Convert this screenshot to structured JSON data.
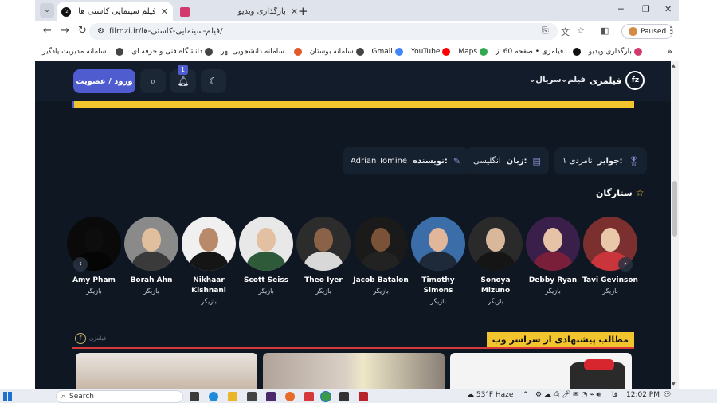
{
  "browser": {
    "tabs": [
      {
        "label": "فیلم سینمایی کاستی ها - فیلمزی",
        "active": true
      },
      {
        "label": "بارگذاری ویدیو",
        "active": false
      }
    ],
    "url": "filmzi.ir/فیلم-سینمایی-کاستی-ها/",
    "profile_label": "Paused",
    "bookmarks": [
      {
        "label": "بارگذاری ویدیو",
        "icon": "upload-icon",
        "color": "#d23a6d"
      },
      {
        "label": "فیلمزی • صفحه 60 از...",
        "icon": "filmzi-icon",
        "color": "#111111"
      },
      {
        "label": "Maps",
        "icon": "maps-icon",
        "color": "#34a853"
      },
      {
        "label": "YouTube",
        "icon": "youtube-icon",
        "color": "#ff0000"
      },
      {
        "label": "Gmail",
        "icon": "google-icon",
        "color": "#4285f4"
      },
      {
        "label": "سامانه بوستان",
        "icon": "bustan-icon",
        "color": "#444444"
      },
      {
        "label": "سامانه دانشجویی بهر...",
        "icon": "student-icon",
        "color": "#e05a2b"
      },
      {
        "label": "دانشگاه فنی و حرفه ای",
        "icon": "university-icon",
        "color": "#444444"
      },
      {
        "label": "سامانه مدیریت یادگیر...",
        "icon": "lms-icon",
        "color": "#444444"
      }
    ]
  },
  "site": {
    "login_label": "ورود / عضویت",
    "notification_count": "1",
    "nav": {
      "film": "فیلم",
      "series": "سریال"
    },
    "logo_mark": "fz",
    "logo_text": "فیلمزی",
    "accent_color": "#4f5ccf",
    "highlight_color": "#f2c42d"
  },
  "info": {
    "awards": {
      "label": "جوایز:",
      "value": "۱ نامزدی"
    },
    "language": {
      "label": "زبان:",
      "value": "انگلیسی"
    },
    "writer": {
      "label": "نویسنده:",
      "value": "Adrian Tomine"
    }
  },
  "cast_section": {
    "title": "ستارگان",
    "members": [
      {
        "name": "Tavi Gevinson",
        "role": "بازیگر",
        "bg": "#7b2f2f",
        "skin": "#e8c8a8",
        "cloth": "#c9353a"
      },
      {
        "name": "Debby Ryan",
        "role": "بازیگر",
        "bg": "#3a1f4a",
        "skin": "#e6c2a6",
        "cloth": "#7a1f3a"
      },
      {
        "name": "Sonoya Mizuno",
        "role": "بازیگر",
        "bg": "#2a2a2a",
        "skin": "#d8b79a",
        "cloth": "#151515"
      },
      {
        "name": "Timothy Simons",
        "role": "بازیگر",
        "bg": "#3b6ea8",
        "skin": "#e2b69a",
        "cloth": "#1e2a3a"
      },
      {
        "name": "Jacob Batalon",
        "role": "بازیگر",
        "bg": "#1a1a1a",
        "skin": "#7a5238",
        "cloth": "#222222"
      },
      {
        "name": "Theo Iyer",
        "role": "بازیگر",
        "bg": "#2c2c2c",
        "skin": "#8a6248",
        "cloth": "#d8d8d8"
      },
      {
        "name": "Scott Seiss",
        "role": "بازیگر",
        "bg": "#e8e8e8",
        "skin": "#e4c0a2",
        "cloth": "#2f5a3a"
      },
      {
        "name": "Nikhaar Kishnani",
        "role": "بازیگر",
        "bg": "#f0f0f0",
        "skin": "#b98a6a",
        "cloth": "#151515"
      },
      {
        "name": "Borah Ahn",
        "role": "بازیگر",
        "bg": "#8a8a8a",
        "skin": "#e0bf9e",
        "cloth": "#3a3a3a"
      },
      {
        "name": "Amy Pham",
        "role": "بازیگر",
        "bg": "#0a0a0a",
        "skin": "#0d0d0d",
        "cloth": "#050505"
      }
    ]
  },
  "suggestions": {
    "title": "مطالب پیشنهادی از سراسر وب",
    "logo_text": "فیلمزی"
  },
  "taskbar": {
    "search_label": "Search",
    "weather": "53°F  Haze",
    "lang": "فا",
    "time": "12:02 PM"
  }
}
